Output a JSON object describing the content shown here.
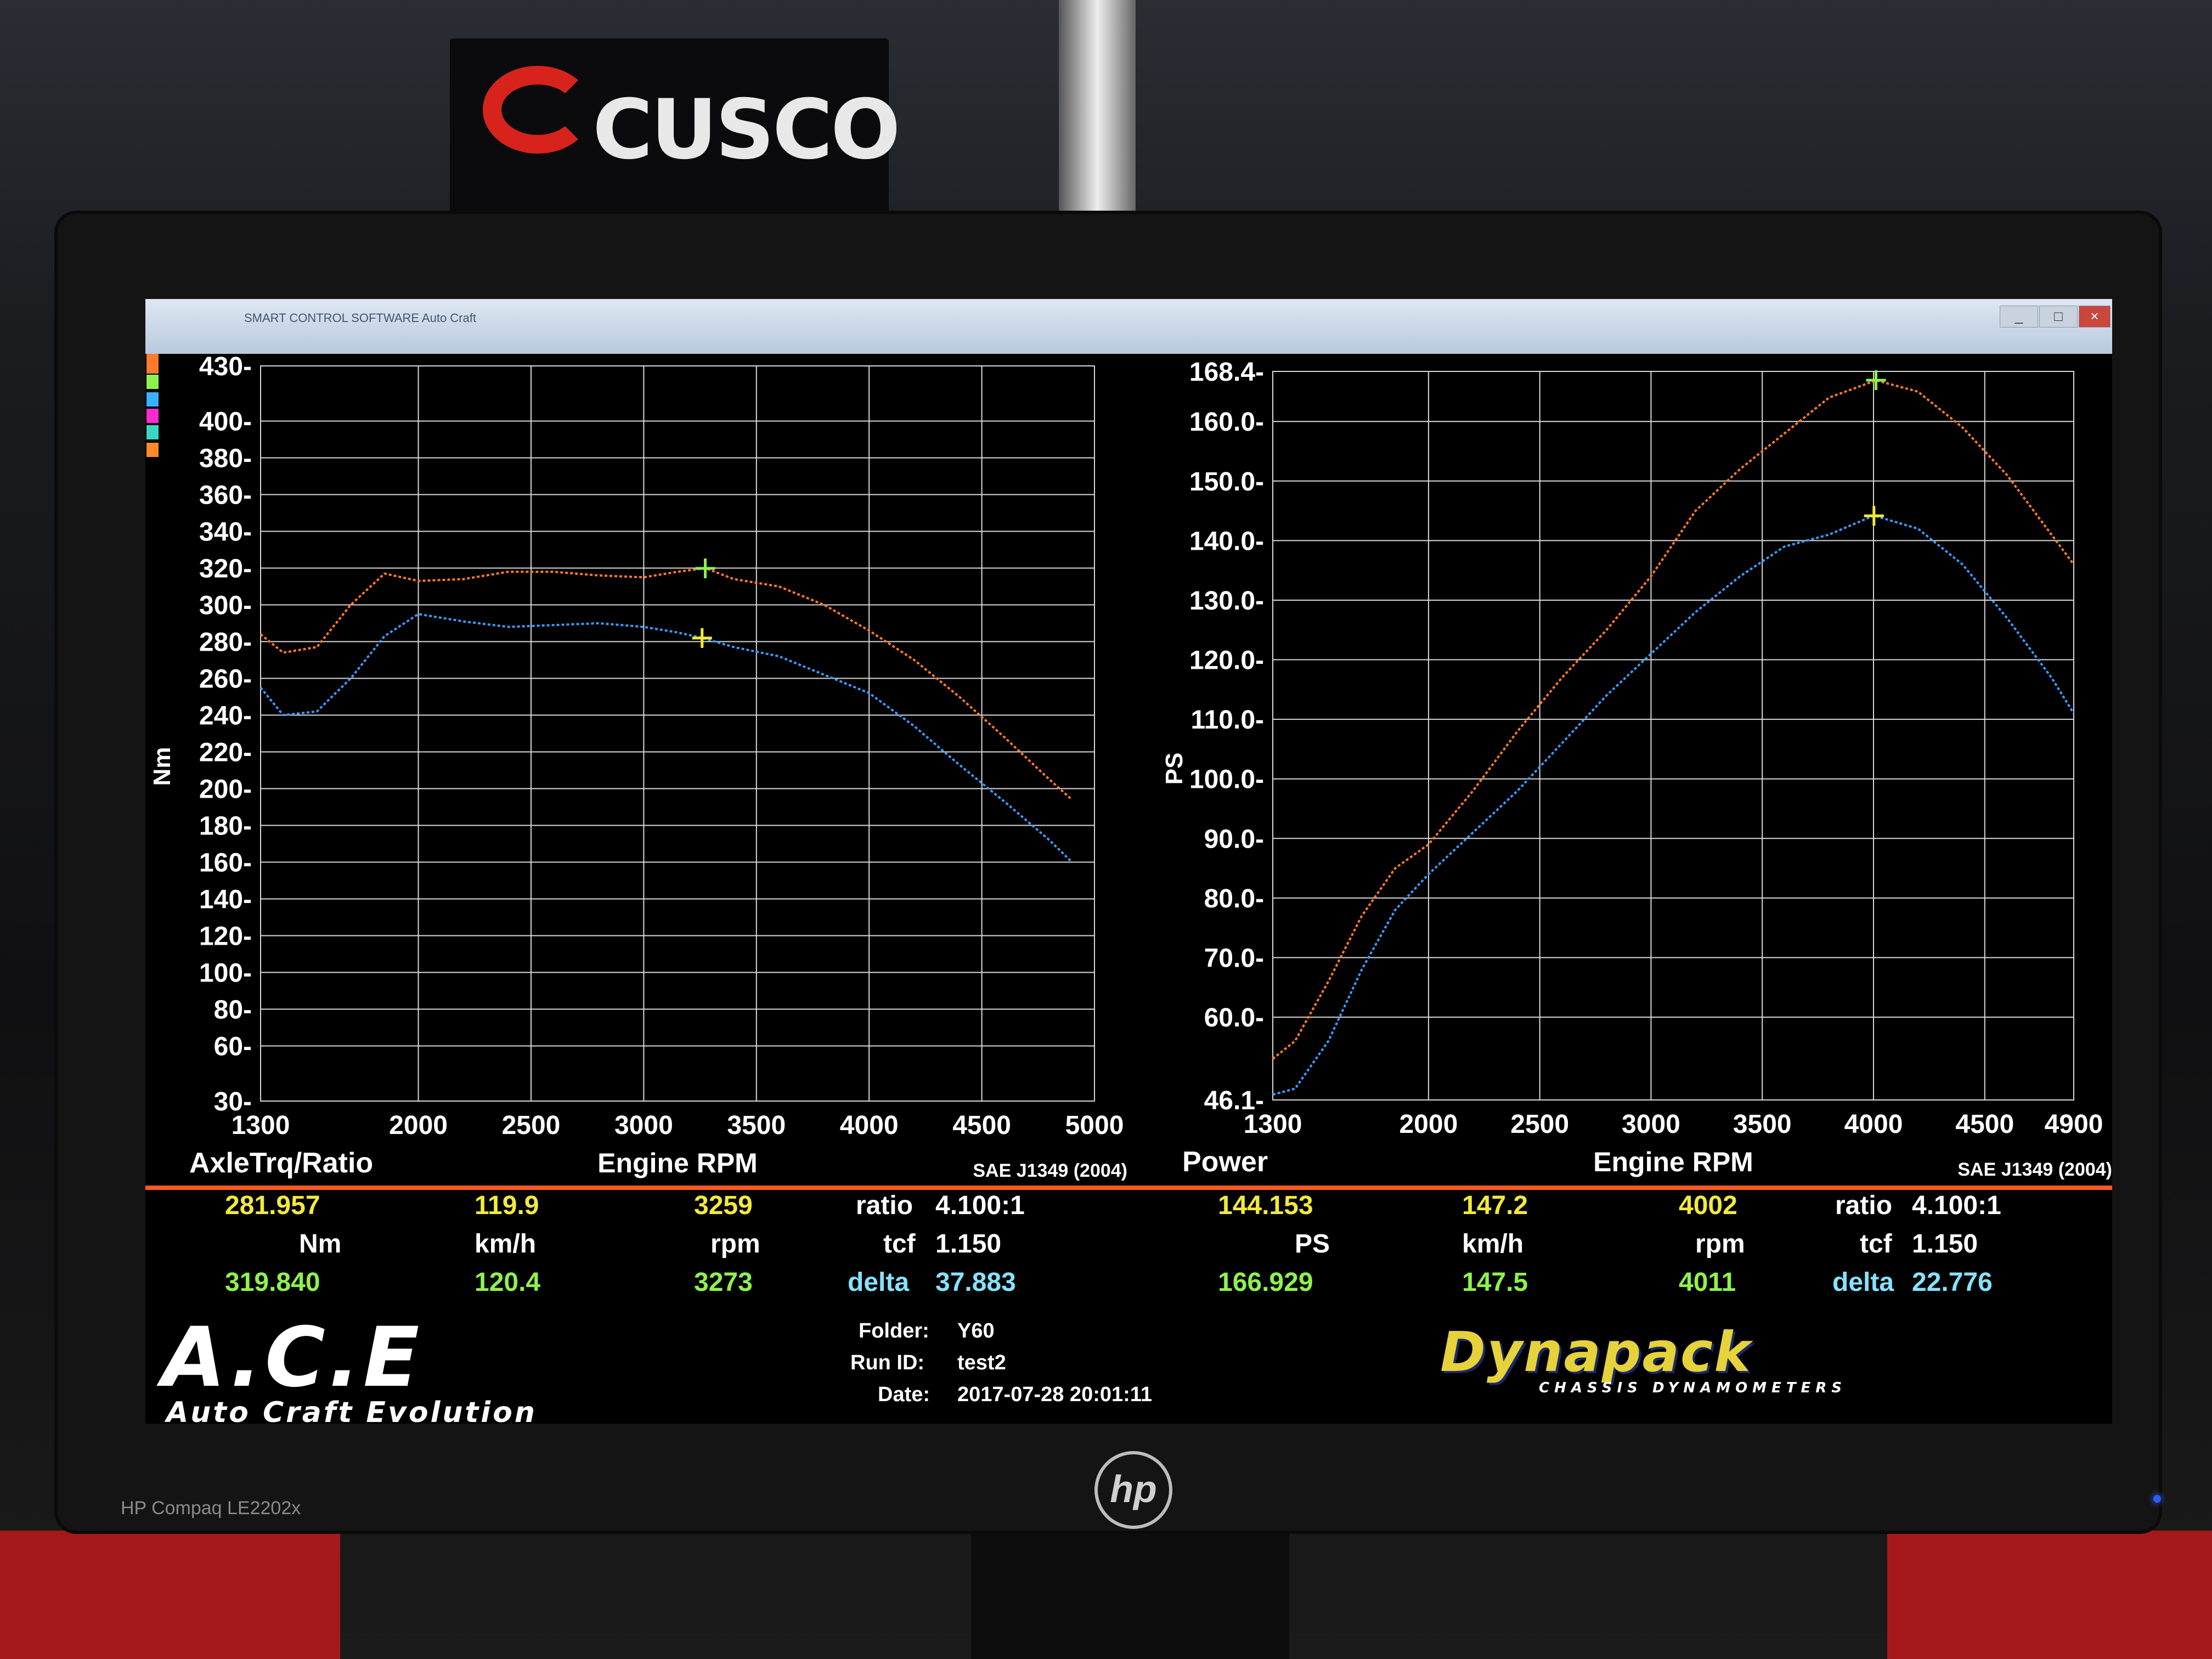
{
  "window": {
    "title": "SMART CONTROL SOFTWARE  Auto Craft"
  },
  "background": {
    "sign_text": "CUSCO",
    "monitor_brand": "HP Compaq LE2202x",
    "hp_logo": "hp"
  },
  "colors": {
    "series_orange": "#ff7a2a",
    "series_blue": "#3b9cff",
    "readout_yellow": "#f2ea3a",
    "readout_green": "#8ef24e",
    "readout_cyan": "#86e2ff",
    "separator": "#ff5a1f"
  },
  "legend_swatches": [
    "#ff7a2a",
    "#8ef24e",
    "#3bb0ff",
    "#ff2ad0",
    "#3bd6c0",
    "#ff8a2a"
  ],
  "chart_data": [
    {
      "type": "line",
      "title": "AxleTrq/Ratio",
      "xlabel": "Engine RPM",
      "ylabel": "Nm",
      "standard": "SAE J1349 (2004)",
      "xlim": [
        1300,
        5000
      ],
      "ylim": [
        30,
        430
      ],
      "x_ticks": [
        "1300",
        "2000",
        "2500",
        "3000",
        "3500",
        "4000",
        "4500",
        "5000"
      ],
      "x_tick_values": [
        1300,
        2000,
        2500,
        3000,
        3500,
        4000,
        4500,
        5000
      ],
      "y_ticks": [
        "430",
        "400",
        "380",
        "360",
        "340",
        "320",
        "300",
        "280",
        "260",
        "240",
        "220",
        "200",
        "180",
        "160",
        "140",
        "120",
        "100",
        "80",
        "60",
        "30"
      ],
      "y_tick_values": [
        430,
        400,
        380,
        360,
        340,
        320,
        300,
        280,
        260,
        240,
        220,
        200,
        180,
        160,
        140,
        120,
        100,
        80,
        60,
        30
      ],
      "grid": true,
      "series": [
        {
          "color": "#ff7a2a",
          "x": [
            1300,
            1400,
            1550,
            1700,
            1850,
            2000,
            2200,
            2400,
            2600,
            2800,
            3000,
            3150,
            3273,
            3400,
            3600,
            3800,
            4000,
            4200,
            4400,
            4600,
            4800,
            4900
          ],
          "y": [
            284,
            274,
            277,
            300,
            317,
            313,
            314,
            318,
            318,
            316,
            315,
            318,
            320,
            314,
            310,
            300,
            286,
            270,
            250,
            228,
            205,
            194
          ]
        },
        {
          "color": "#3b9cff",
          "x": [
            1300,
            1400,
            1550,
            1700,
            1850,
            2000,
            2200,
            2400,
            2600,
            2800,
            3000,
            3150,
            3259,
            3400,
            3600,
            3800,
            4000,
            4200,
            4400,
            4600,
            4800,
            4900
          ],
          "y": [
            255,
            240,
            242,
            260,
            283,
            295,
            291,
            288,
            289,
            290,
            288,
            285,
            282,
            277,
            272,
            262,
            252,
            234,
            213,
            193,
            172,
            160
          ]
        }
      ],
      "markers": [
        {
          "x": 3273,
          "y": 319.84,
          "color": "#8ef24e"
        },
        {
          "x": 3259,
          "y": 281.957,
          "color": "#f2ea3a"
        }
      ]
    },
    {
      "type": "line",
      "title": "Power",
      "xlabel": "Engine RPM",
      "ylabel": "PS",
      "standard": "SAE J1349 (2004)",
      "xlim": [
        1300,
        4900
      ],
      "ylim": [
        46.1,
        168.4
      ],
      "x_ticks": [
        "1300",
        "2000",
        "2500",
        "3000",
        "3500",
        "4000",
        "4500",
        "4900"
      ],
      "x_tick_values": [
        1300,
        2000,
        2500,
        3000,
        3500,
        4000,
        4500,
        4900
      ],
      "y_ticks": [
        "168.4",
        "160.0",
        "150.0",
        "140.0",
        "130.0",
        "120.0",
        "110.0",
        "100.0",
        "90.0",
        "80.0",
        "70.0",
        "60.0",
        "46.1"
      ],
      "y_tick_values": [
        168.4,
        160,
        150,
        140,
        130,
        120,
        110,
        100,
        90,
        80,
        70,
        60,
        46.1
      ],
      "grid": true,
      "series": [
        {
          "color": "#ff7a2a",
          "x": [
            1300,
            1400,
            1550,
            1700,
            1850,
            2000,
            2200,
            2400,
            2600,
            2800,
            3000,
            3200,
            3400,
            3600,
            3800,
            4011,
            4200,
            4400,
            4600,
            4800,
            4900
          ],
          "y": [
            53,
            56,
            66,
            77,
            85,
            89,
            98,
            108,
            117,
            125,
            134,
            145,
            152,
            158,
            164,
            166.9,
            165,
            159,
            151,
            141,
            136
          ]
        },
        {
          "color": "#3b9cff",
          "x": [
            1300,
            1400,
            1550,
            1700,
            1850,
            2000,
            2200,
            2400,
            2600,
            2800,
            3000,
            3200,
            3400,
            3600,
            3800,
            4002,
            4200,
            4400,
            4600,
            4800,
            4900
          ],
          "y": [
            47,
            48,
            56,
            68,
            78,
            84,
            91,
            98,
            106,
            114,
            121,
            128,
            134,
            139,
            141,
            144.2,
            142,
            136,
            127,
            117,
            111
          ]
        }
      ],
      "markers": [
        {
          "x": 4011,
          "y": 166.929,
          "color": "#8ef24e"
        },
        {
          "x": 4002,
          "y": 144.153,
          "color": "#f2ea3a"
        }
      ]
    }
  ],
  "readout_left": {
    "row1": {
      "value": "281.957",
      "speed": "119.9",
      "rpm": "3259",
      "ratio_label": "ratio",
      "ratio": "4.100:1"
    },
    "row2": {
      "unit": "Nm",
      "speed_unit": "km/h",
      "rpm_unit": "rpm",
      "tcf_label": "tcf",
      "tcf": "1.150"
    },
    "row3": {
      "value": "319.840",
      "speed": "120.4",
      "rpm": "3273",
      "delta_label": "delta",
      "delta": "37.883"
    }
  },
  "readout_right": {
    "row1": {
      "value": "144.153",
      "speed": "147.2",
      "rpm": "4002",
      "ratio_label": "ratio",
      "ratio": "4.100:1"
    },
    "row2": {
      "unit": "PS",
      "speed_unit": "km/h",
      "rpm_unit": "rpm",
      "tcf_label": "tcf",
      "tcf": "1.150"
    },
    "row3": {
      "value": "166.929",
      "speed": "147.5",
      "rpm": "4011",
      "delta_label": "delta",
      "delta": "22.776"
    }
  },
  "run_info": {
    "folder_label": "Folder:",
    "folder": "Y60",
    "run_label": "Run ID:",
    "run": "test2",
    "date_label": "Date:",
    "date": "2017-07-28 20:01:11"
  },
  "logos": {
    "ace": "A.C.E",
    "ace_sub": "Auto Craft Evolution",
    "dynapack": "Dynapack",
    "dynapack_sub": "CHASSIS DYNAMOMETERS"
  }
}
